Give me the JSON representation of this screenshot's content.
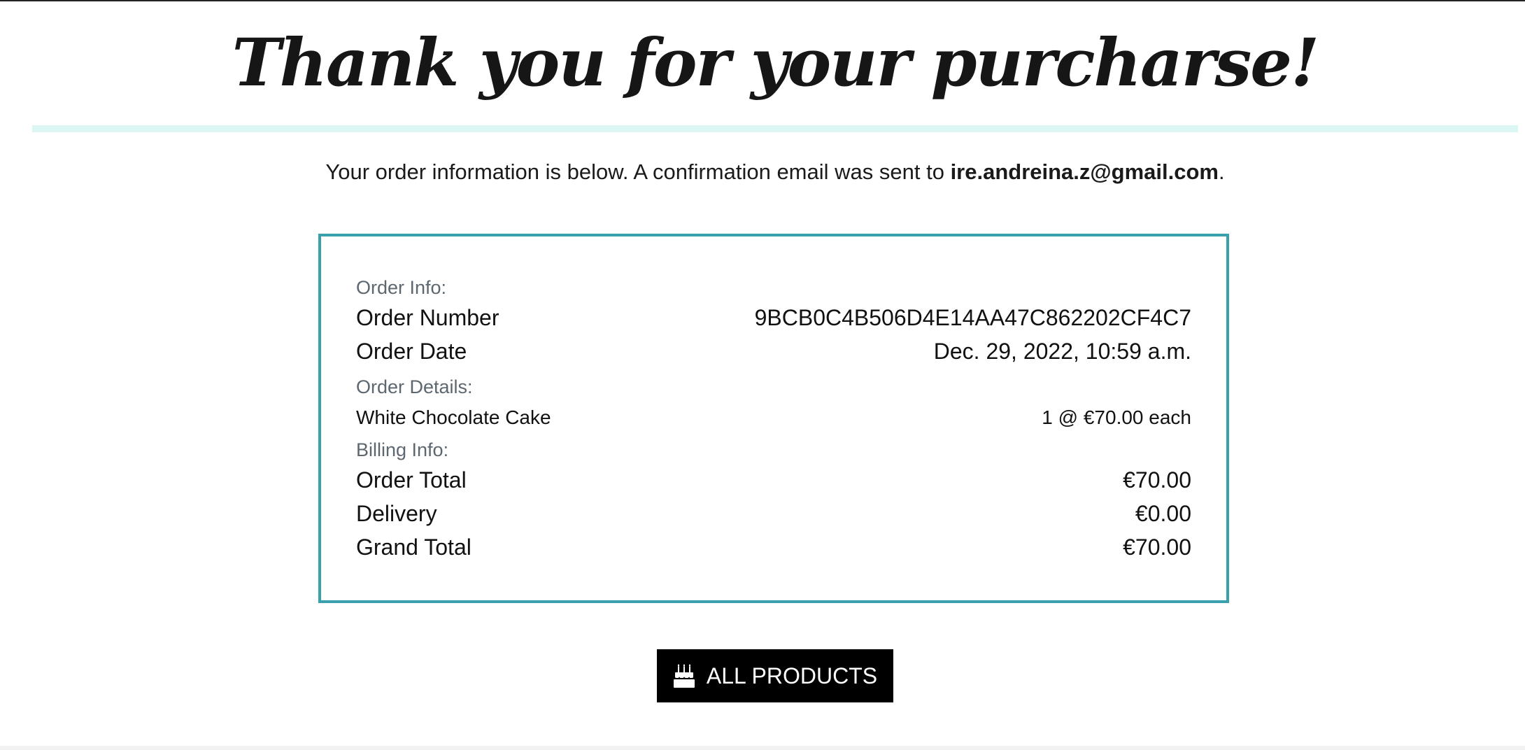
{
  "header": {
    "title": "Thank you for your purcharse!"
  },
  "intro": {
    "text_before": "Your order information is below. A confirmation email was sent to ",
    "email": "ire.andreina.z@gmail.com",
    "text_after": "."
  },
  "order": {
    "order_info_label": "Order Info:",
    "order_number_label": "Order Number",
    "order_number": "9BCB0C4B506D4E14AA47C862202CF4C7",
    "order_date_label": "Order Date",
    "order_date": "Dec. 29, 2022, 10:59 a.m.",
    "order_details_label": "Order Details:",
    "items": [
      {
        "name": "White Chocolate Cake",
        "qty_price": "1 @ €70.00 each"
      }
    ],
    "billing_info_label": "Billing Info:",
    "order_total_label": "Order Total",
    "order_total": "€70.00",
    "delivery_label": "Delivery",
    "delivery": "€0.00",
    "grand_total_label": "Grand Total",
    "grand_total": "€70.00"
  },
  "actions": {
    "all_products_label": "ALL PRODUCTS",
    "all_products_icon": "birthday-cake-icon"
  },
  "colors": {
    "divider": "#dcf7f3",
    "box_border": "#3aa0ad",
    "button_bg": "#000000",
    "muted_label": "#5d6770"
  }
}
